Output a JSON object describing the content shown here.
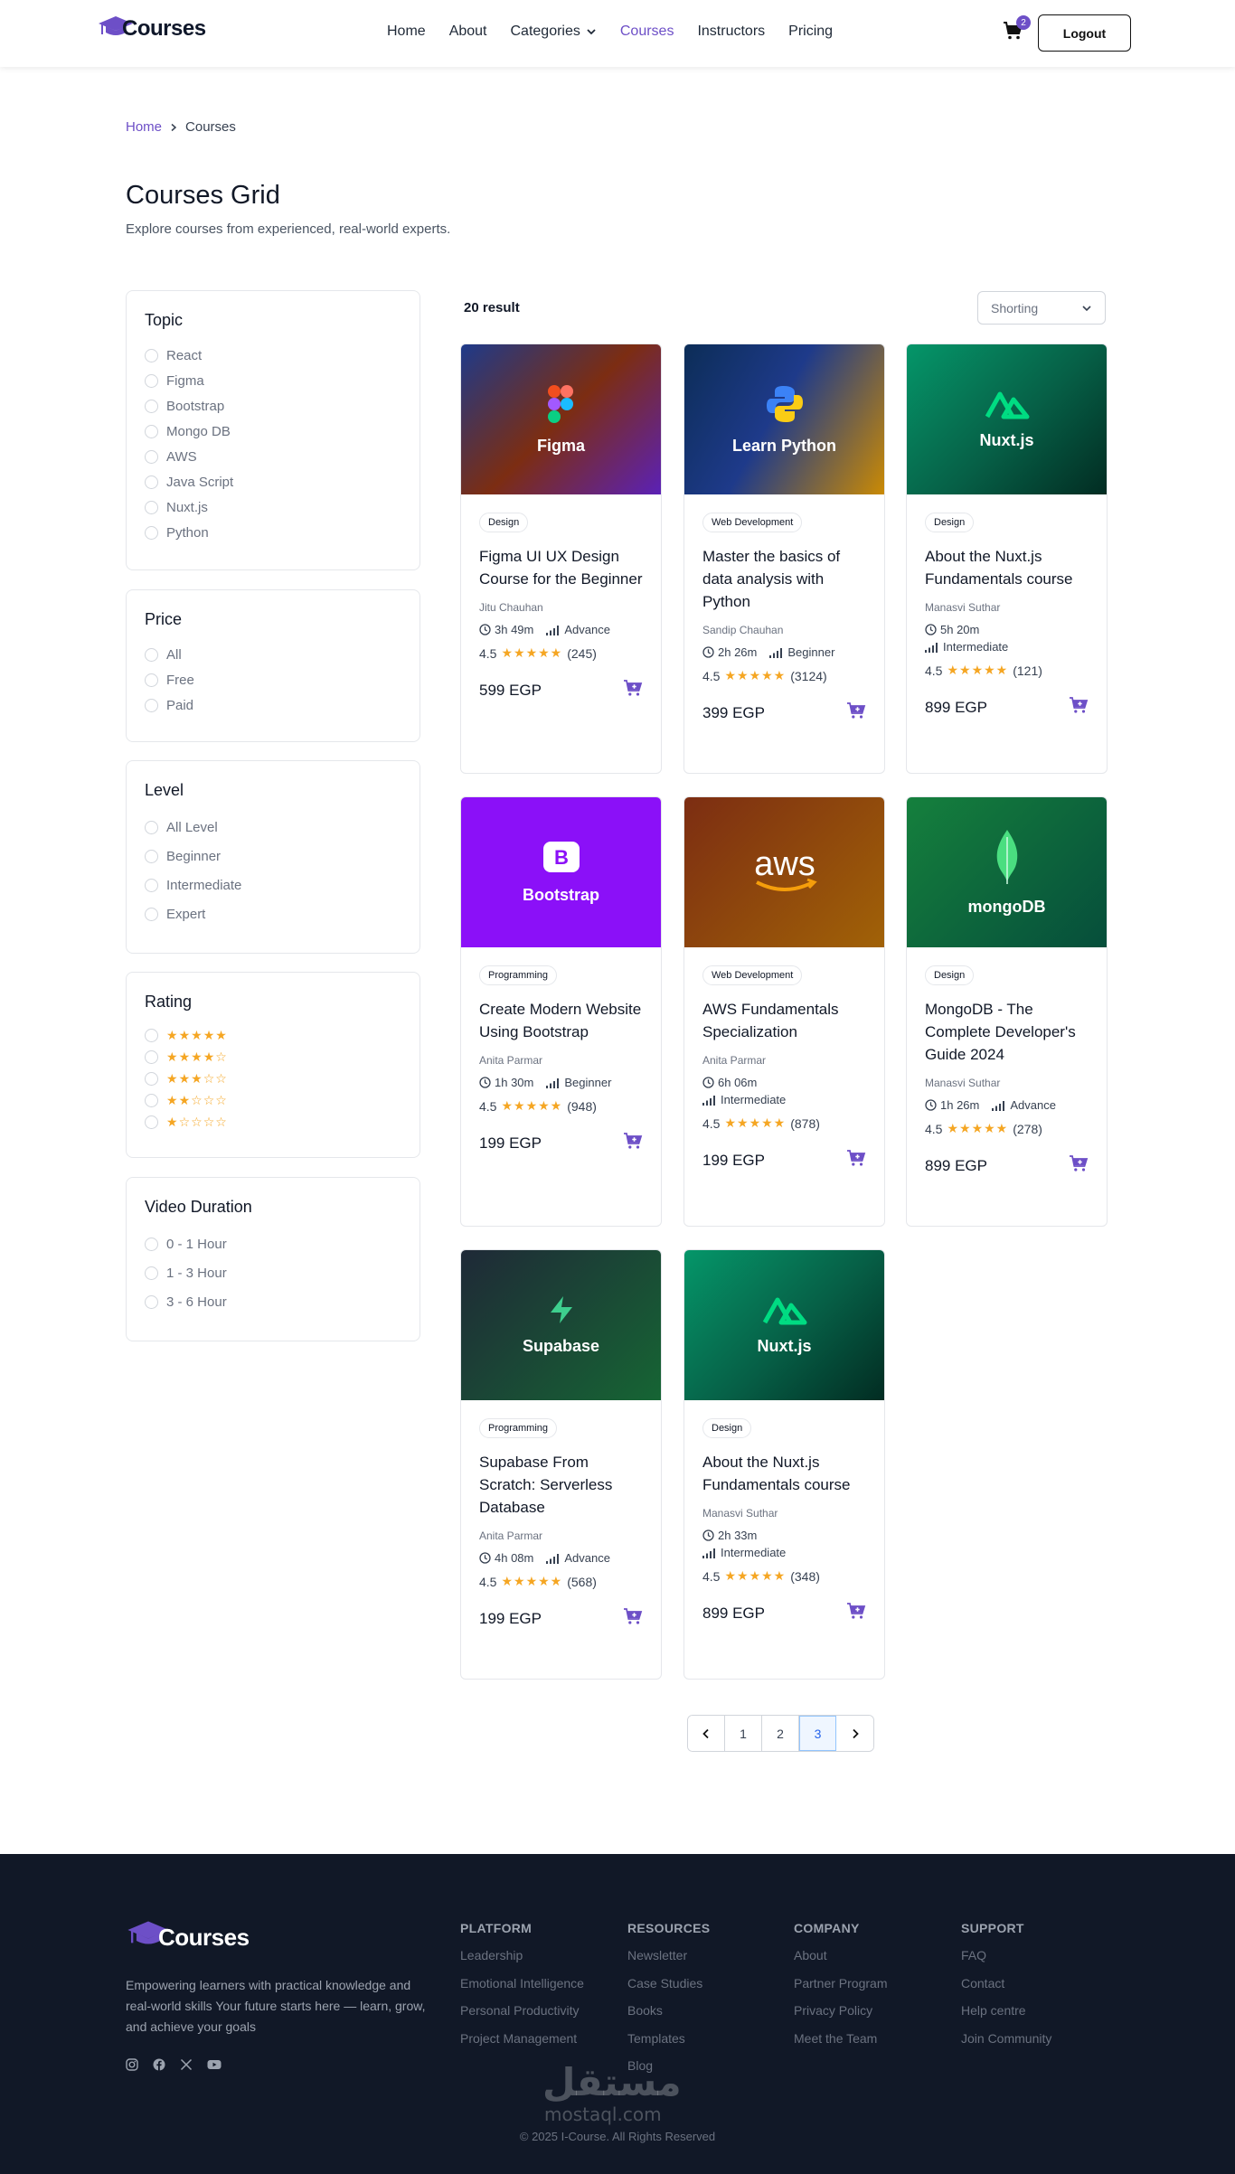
{
  "nav": {
    "logo": "Courses",
    "links": [
      {
        "label": "Home",
        "active": false
      },
      {
        "label": "About",
        "active": false
      },
      {
        "label": "Categories",
        "active": false
      },
      {
        "label": "Courses",
        "active": true
      },
      {
        "label": "Instructors",
        "active": false
      },
      {
        "label": "Pricing",
        "active": false
      }
    ],
    "cart_count": "2",
    "logout": "Logout"
  },
  "breadcrumb": {
    "home": "Home",
    "current": "Courses"
  },
  "header": {
    "title": "Courses Grid",
    "subtitle": "Explore courses from experienced, real-world experts."
  },
  "filters": {
    "topic": {
      "title": "Topic",
      "options": [
        "React",
        "Figma",
        "Bootstrap",
        "Mongo DB",
        "AWS",
        "Java Script",
        "Nuxt.js",
        "Python"
      ]
    },
    "price": {
      "title": "Price",
      "options": [
        "All",
        "Free",
        "Paid"
      ]
    },
    "level": {
      "title": "Level",
      "options": [
        "All Level",
        "Beginner",
        "Intermediate",
        "Expert"
      ]
    },
    "rating": {
      "title": "Rating",
      "options": [
        5,
        4,
        3,
        2,
        1
      ]
    },
    "duration": {
      "title": "Video Duration",
      "options": [
        "0 - 1 Hour",
        "1 - 3 Hour",
        "3 - 6 Hour"
      ]
    }
  },
  "results": {
    "count": "20 result",
    "sort": "Shorting"
  },
  "colors": {
    "accent": "#6d4fc7",
    "star": "#f5a623",
    "footer_bg": "#111827"
  },
  "courses": [
    {
      "thumb": "Figma",
      "icon": "figma-icon",
      "tag": "Design",
      "title": "Figma UI UX Design Course for the Beginner",
      "author": "Jitu Chauhan",
      "duration": "3h 49m",
      "level": "Advance",
      "rating": "4.5",
      "reviews": "(245)",
      "price": "599 EGP"
    },
    {
      "thumb": "Learn Python",
      "icon": "python-icon",
      "tag": "Web Development",
      "title": "Master the basics of data analysis with Python",
      "author": "Sandip Chauhan",
      "duration": "2h 26m",
      "level": "Beginner",
      "rating": "4.5",
      "reviews": "(3124)",
      "price": "399 EGP"
    },
    {
      "thumb": "Nuxt.js",
      "icon": "nuxt-icon",
      "tag": "Design",
      "title": "About the Nuxt.js Fundamentals course",
      "author": "Manasvi Suthar",
      "duration": "5h 20m",
      "level": "Intermediate",
      "rating": "4.5",
      "reviews": "(121)",
      "price": "899 EGP"
    },
    {
      "thumb": "Bootstrap",
      "icon": "bootstrap-icon",
      "tag": "Programming",
      "title": "Create Modern Website Using Bootstrap",
      "author": "Anita Parmar",
      "duration": "1h 30m",
      "level": "Beginner",
      "rating": "4.5",
      "reviews": "(948)",
      "price": "199 EGP"
    },
    {
      "thumb": "aws",
      "icon": "aws-icon",
      "tag": "Web Development",
      "title": "AWS Fundamentals Specialization",
      "author": "Anita Parmar",
      "duration": "6h 06m",
      "level": "Intermediate",
      "rating": "4.5",
      "reviews": "(878)",
      "price": "199 EGP"
    },
    {
      "thumb": "mongoDB",
      "icon": "mongodb-icon",
      "tag": "Design",
      "title": "MongoDB - The Complete Developer's Guide 2024",
      "author": "Manasvi Suthar",
      "duration": "1h 26m",
      "level": "Advance",
      "rating": "4.5",
      "reviews": "(278)",
      "price": "899 EGP"
    },
    {
      "thumb": "Supabase",
      "icon": "supabase-icon",
      "tag": "Programming",
      "title": "Supabase From Scratch: Serverless Database",
      "author": "Anita Parmar",
      "duration": "4h 08m",
      "level": "Advance",
      "rating": "4.5",
      "reviews": "(568)",
      "price": "199 EGP"
    },
    {
      "thumb": "Nuxt.js",
      "icon": "nuxt-icon",
      "tag": "Design",
      "title": "About the Nuxt.js Fundamentals course",
      "author": "Manasvi Suthar",
      "duration": "2h 33m",
      "level": "Intermediate",
      "rating": "4.5",
      "reviews": "(348)",
      "price": "899 EGP"
    }
  ],
  "pagination": {
    "pages": [
      "1",
      "2",
      "3"
    ],
    "active": "3"
  },
  "footer": {
    "logo": "Courses",
    "description": "Empowering learners with practical knowledge and real-world skills Your future starts here — learn, grow, and achieve your goals",
    "columns": [
      {
        "title": "PLATFORM",
        "links": [
          "Leadership",
          "Emotional Intelligence",
          "Personal Productivity",
          "Project Management"
        ]
      },
      {
        "title": "RESOURCES",
        "links": [
          "Newsletter",
          "Case Studies",
          "Books",
          "Templates",
          "Blog"
        ]
      },
      {
        "title": "COMPANY",
        "links": [
          "About",
          "Partner Program",
          "Privacy Policy",
          "Meet the Team"
        ]
      },
      {
        "title": "SUPPORT",
        "links": [
          "FAQ",
          "Contact",
          "Help centre",
          "Join Community"
        ]
      }
    ],
    "copyright": "© 2025 I-Course. All Rights Reserved",
    "watermark": "مستقل",
    "watermark_url": "mostaql.com"
  }
}
